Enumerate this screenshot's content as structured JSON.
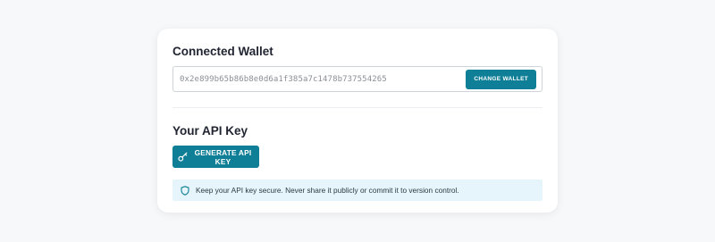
{
  "wallet_section": {
    "title": "Connected Wallet",
    "address": "0x2e899b65b86b8e0d6a1f385a7c1478b737554265",
    "change_label": "CHANGE WALLET"
  },
  "api_section": {
    "title": "Your API Key",
    "generate_label": "GENERATE API KEY",
    "alert_text": "Keep your API key secure. Never share it publicly or commit it to version control."
  },
  "icons": {
    "key": "key-icon",
    "shield": "shield-icon"
  },
  "colors": {
    "accent": "#0e7f96",
    "alert_background": "#e6f4fb",
    "page_background": "#f7f8fa"
  }
}
